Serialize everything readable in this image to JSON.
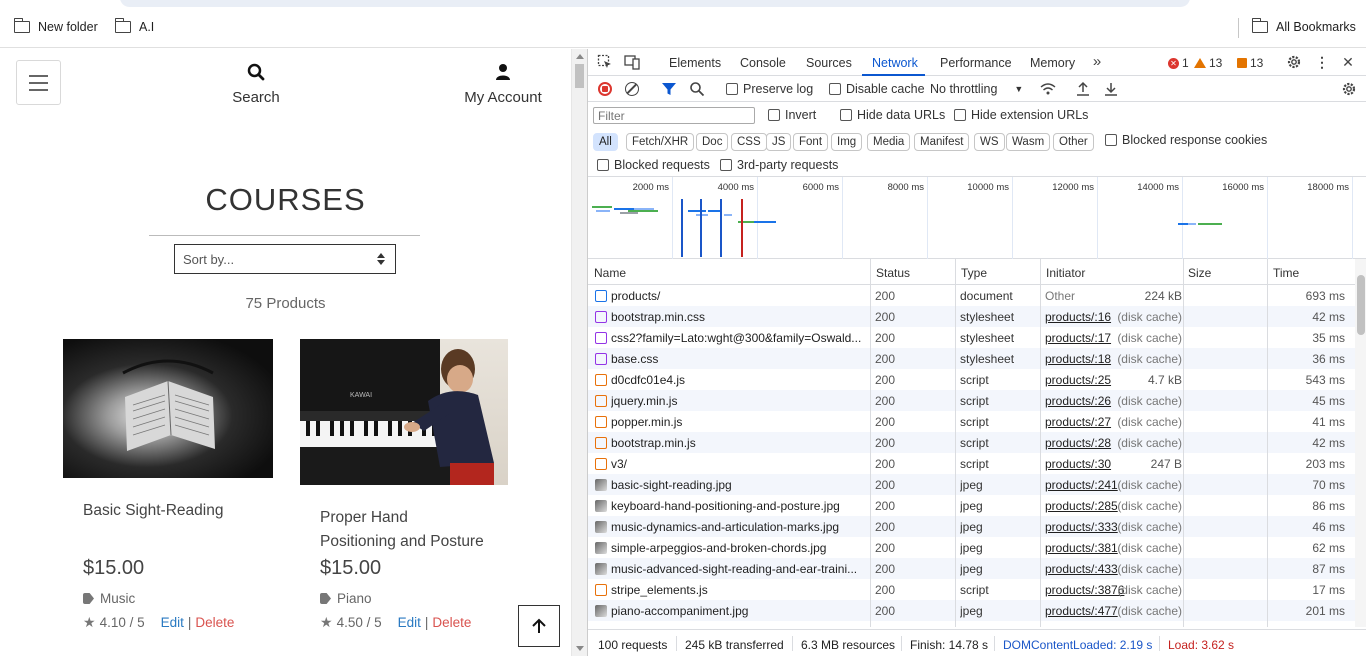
{
  "bookmarks": {
    "items": [
      {
        "label": "New folder",
        "icon": "folder-icon"
      },
      {
        "label": "A.I",
        "icon": "folder-icon"
      }
    ],
    "all_bookmarks": "All Bookmarks"
  },
  "site": {
    "nav": {
      "search": "Search",
      "account": "My Account"
    },
    "title": "COURSES",
    "sort_placeholder": "Sort by...",
    "product_count": "75 Products",
    "products": [
      {
        "name": "Basic Sight-Reading",
        "price": "$15.00",
        "category": "Music",
        "rating": "4.10 / 5",
        "edit": "Edit",
        "sep": "|",
        "delete": "Delete"
      },
      {
        "name": "Proper Hand Positioning and Posture",
        "price": "$15.00",
        "category": "Piano",
        "rating": "4.50 / 5",
        "edit": "Edit",
        "sep": "|",
        "delete": "Delete"
      }
    ]
  },
  "devtools": {
    "tabs": [
      "Elements",
      "Console",
      "Sources",
      "Network",
      "Performance",
      "Memory"
    ],
    "active_tab": "Network",
    "errors": "1",
    "warnings": "13",
    "issues": "13",
    "toolbar": {
      "preserve_log": "Preserve log",
      "disable_cache": "Disable cache",
      "throttling": "No throttling"
    },
    "filter": {
      "placeholder": "Filter",
      "invert": "Invert",
      "hide_data_urls": "Hide data URLs",
      "hide_extension_urls": "Hide extension URLs"
    },
    "type_filters": [
      "All",
      "Fetch/XHR",
      "Doc",
      "CSS",
      "JS",
      "Font",
      "Img",
      "Media",
      "Manifest",
      "WS",
      "Wasm",
      "Other"
    ],
    "blocked_response_cookies": "Blocked response cookies",
    "blocked_requests": "Blocked requests",
    "third_party_requests": "3rd-party requests",
    "timeline_ticks": [
      "2000 ms",
      "4000 ms",
      "6000 ms",
      "8000 ms",
      "10000 ms",
      "12000 ms",
      "14000 ms",
      "16000 ms",
      "18000 ms"
    ],
    "columns": [
      "Name",
      "Status",
      "Type",
      "Initiator",
      "Size",
      "Time"
    ],
    "requests": [
      {
        "name": "products/",
        "status": "200",
        "type": "document",
        "initiator": "Other",
        "size": "224 kB",
        "time": "693 ms",
        "icon": "doc"
      },
      {
        "name": "bootstrap.min.css",
        "status": "200",
        "type": "stylesheet",
        "initiator": "products/:16",
        "size": "(disk cache)",
        "time": "42 ms",
        "icon": "css"
      },
      {
        "name": "css2?family=Lato:wght@300&family=Oswald...",
        "status": "200",
        "type": "stylesheet",
        "initiator": "products/:17",
        "size": "(disk cache)",
        "time": "35 ms",
        "icon": "css"
      },
      {
        "name": "base.css",
        "status": "200",
        "type": "stylesheet",
        "initiator": "products/:18",
        "size": "(disk cache)",
        "time": "36 ms",
        "icon": "css"
      },
      {
        "name": "d0cdfc01e4.js",
        "status": "200",
        "type": "script",
        "initiator": "products/:25",
        "size": "4.7 kB",
        "time": "543 ms",
        "icon": "js"
      },
      {
        "name": "jquery.min.js",
        "status": "200",
        "type": "script",
        "initiator": "products/:26",
        "size": "(disk cache)",
        "time": "45 ms",
        "icon": "js"
      },
      {
        "name": "popper.min.js",
        "status": "200",
        "type": "script",
        "initiator": "products/:27",
        "size": "(disk cache)",
        "time": "41 ms",
        "icon": "js"
      },
      {
        "name": "bootstrap.min.js",
        "status": "200",
        "type": "script",
        "initiator": "products/:28",
        "size": "(disk cache)",
        "time": "42 ms",
        "icon": "js"
      },
      {
        "name": "v3/",
        "status": "200",
        "type": "script",
        "initiator": "products/:30",
        "size": "247 B",
        "time": "203 ms",
        "icon": "js"
      },
      {
        "name": "basic-sight-reading.jpg",
        "status": "200",
        "type": "jpeg",
        "initiator": "products/:241",
        "size": "(disk cache)",
        "time": "70 ms",
        "icon": "img"
      },
      {
        "name": "keyboard-hand-positioning-and-posture.jpg",
        "status": "200",
        "type": "jpeg",
        "initiator": "products/:285",
        "size": "(disk cache)",
        "time": "86 ms",
        "icon": "img"
      },
      {
        "name": "music-dynamics-and-articulation-marks.jpg",
        "status": "200",
        "type": "jpeg",
        "initiator": "products/:333",
        "size": "(disk cache)",
        "time": "46 ms",
        "icon": "img"
      },
      {
        "name": "simple-arpeggios-and-broken-chords.jpg",
        "status": "200",
        "type": "jpeg",
        "initiator": "products/:381",
        "size": "(disk cache)",
        "time": "62 ms",
        "icon": "img"
      },
      {
        "name": "music-advanced-sight-reading-and-ear-traini...",
        "status": "200",
        "type": "jpeg",
        "initiator": "products/:433",
        "size": "(disk cache)",
        "time": "87 ms",
        "icon": "img"
      },
      {
        "name": "stripe_elements.js",
        "status": "200",
        "type": "script",
        "initiator": "products/:3876",
        "size": "(disk cache)",
        "time": "17 ms",
        "icon": "js"
      },
      {
        "name": "piano-accompaniment.jpg",
        "status": "200",
        "type": "jpeg",
        "initiator": "products/:477",
        "size": "(disk cache)",
        "time": "201 ms",
        "icon": "img"
      }
    ],
    "summary": {
      "requests": "100 requests",
      "transferred": "245 kB transferred",
      "resources": "6.3 MB resources",
      "finish": "Finish: 14.78 s",
      "dom_content_loaded": "DOMContentLoaded: 2.19 s",
      "load": "Load: 3.62 s"
    },
    "colors": {
      "accent": "#0b57d0",
      "dcl": "#1a56c8",
      "load": "#c5221f"
    }
  }
}
